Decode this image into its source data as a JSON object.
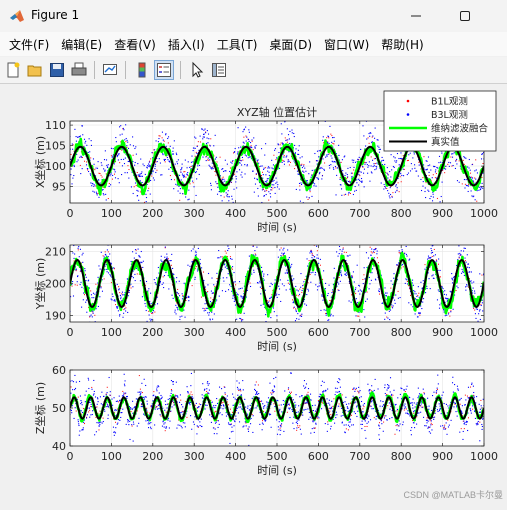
{
  "window": {
    "title": "Figure 1"
  },
  "menu": [
    "文件(F)",
    "编辑(E)",
    "查看(V)",
    "插入(I)",
    "工具(T)",
    "桌面(D)",
    "窗口(W)",
    "帮助(H)"
  ],
  "toolbar_icons": [
    "new-figure-icon",
    "open-file-icon",
    "save-icon",
    "print-icon",
    "link-plot-icon",
    "insert-colorbar-icon",
    "insert-legend-icon",
    "edit-plot-icon",
    "property-inspector-icon"
  ],
  "colors": {
    "b1l": "#ff0000",
    "b3l": "#0000ff",
    "fusion": "#00ff00",
    "truth": "#000000"
  },
  "chart_data": [
    {
      "type": "line",
      "title": "XYZ轴 位置估计",
      "xlabel": "时间 (s)",
      "ylabel": "X坐标 (m)",
      "xlim": [
        0,
        1000
      ],
      "ylim": [
        91,
        111
      ],
      "xticks": [
        0,
        100,
        200,
        300,
        400,
        500,
        600,
        700,
        800,
        900,
        1000
      ],
      "yticks": [
        95,
        100,
        105,
        110
      ],
      "signal": {
        "offset": 100,
        "amplitude": 4.7,
        "period_s": 100,
        "noise_b1l": 2.2,
        "noise_b3l": 3.2
      },
      "legend": {
        "position": "top-right",
        "entries": [
          "B1L观测",
          "B3L观测",
          "维纳滤波融合",
          "真实值"
        ]
      }
    },
    {
      "type": "line",
      "title": "",
      "xlabel": "时间 (s)",
      "ylabel": "Y坐标 (m)",
      "xlim": [
        0,
        1000
      ],
      "ylim": [
        188,
        212
      ],
      "xticks": [
        0,
        100,
        200,
        300,
        400,
        500,
        600,
        700,
        800,
        900,
        1000
      ],
      "yticks": [
        190,
        200,
        210
      ],
      "signal": {
        "offset": 200,
        "amplitude": 7.3,
        "period_s": 71.4,
        "noise_b1l": 2.6,
        "noise_b3l": 3.6
      }
    },
    {
      "type": "line",
      "title": "",
      "xlabel": "时间 (s)",
      "ylabel": "Z坐标 (m)",
      "xlim": [
        0,
        1000
      ],
      "ylim": [
        40,
        60
      ],
      "xticks": [
        0,
        100,
        200,
        300,
        400,
        500,
        600,
        700,
        800,
        900,
        1000
      ],
      "yticks": [
        40,
        50,
        60
      ],
      "signal": {
        "offset": 50,
        "amplitude": 2.8,
        "period_s": 40,
        "noise_b1l": 1.8,
        "noise_b3l": 2.6
      }
    }
  ],
  "watermark": "CSDN @MATLAB卡尔曼"
}
